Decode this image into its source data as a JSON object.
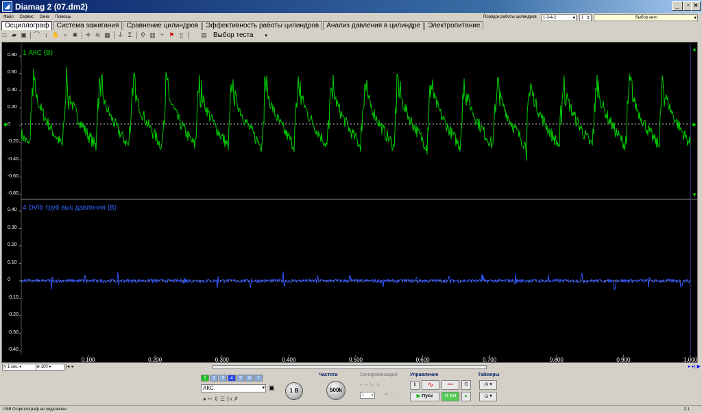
{
  "window": {
    "title": "Diamag 2 (07.dm2)",
    "buttons": [
      "_",
      "▫",
      "×"
    ]
  },
  "menu": [
    "Файл",
    "Сервис",
    "Окна",
    "Помощь"
  ],
  "cylinders": {
    "label": "Порядок работы цилиндров",
    "order": "1-3-4-2",
    "count": "1",
    "auto": "Выбор авто"
  },
  "tabs": [
    "Осциллограф",
    "Система зажигания",
    "Сравнение цилиндров",
    "Эффективность работы цилиндров",
    "Анализ давления в цилиндре",
    "Электропитание"
  ],
  "toolbar": {
    "test_label": "Выбор теста"
  },
  "channels": [
    {
      "name": "1 АКС (В)",
      "color": "#00d000",
      "yticks": [
        "0.80",
        "0.60",
        "0.40",
        "0.20",
        "0",
        "-0.20",
        "-0.40",
        "-0.60",
        "-0.80"
      ]
    },
    {
      "name": "4 DVib труб выс давления (В)",
      "color": "#3355ff",
      "yticks": [
        "0.40",
        "0.30",
        "0.20",
        "0.10",
        "0",
        "-0.10",
        "-0.20",
        "-0.30",
        "-0.40"
      ]
    }
  ],
  "xaxis": {
    "ticks": [
      "0.100",
      "0.200",
      "0.300",
      "0.400",
      "0.500",
      "0.600",
      "0.700",
      "0.800",
      "0.900",
      "1.000"
    ]
  },
  "scroll": {
    "timebase": "1 сек.",
    "zoom": "100"
  },
  "controls": {
    "channel_buttons": [
      "1",
      "2",
      "3",
      "4",
      "5",
      "6",
      "7"
    ],
    "channel_name": "АКС",
    "knob1": "1 В",
    "freq_label": "Частота",
    "freq_value": "500k",
    "sync_label": "Синхронизация",
    "sync_value": "1",
    "ctrl_label": "Управление",
    "start_label": "Пуск",
    "timers_label": "Таймеры"
  },
  "status": {
    "left": "USB Осциллограф не подключен",
    "right": "2.1"
  }
}
